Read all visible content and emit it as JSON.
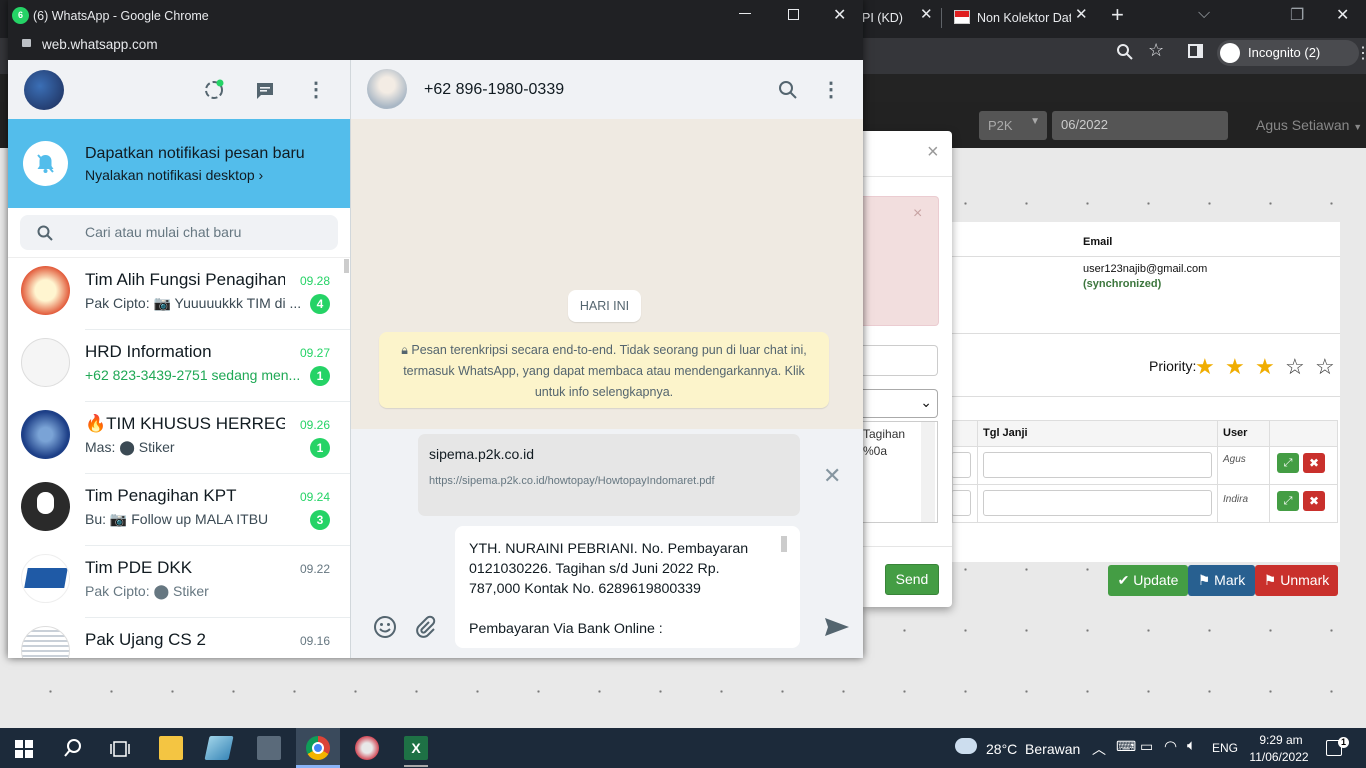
{
  "bg_chrome": {
    "tab1_label": "PI (KD)",
    "tab2_label": "Non Kolektor Dat",
    "incognito_label": "Incognito (2)"
  },
  "bg_page": {
    "program_select": "P2K",
    "period_input": "06/2022",
    "user_menu": "Agus Setiawan",
    "email_header": "Email",
    "email_value": "user123najib@gmail.com",
    "sync_status": "(synchronized)",
    "priority_label": "Priority:",
    "priority_stars": 3,
    "priority_max": 5,
    "col_tgl_janji": "Tgl Janji",
    "col_user": "User",
    "row1_user": "Agus",
    "row2_user": "Indira",
    "textarea_snippet_1": "Tagihan",
    "textarea_snippet_2": "%0a",
    "send_btn": "Send",
    "update_btn": "Update",
    "mark_btn": "Mark",
    "unmark_btn": "Unmark",
    "close_glyph": "×"
  },
  "window": {
    "title": "(6) WhatsApp - Google Chrome",
    "url": "web.whatsapp.com"
  },
  "wa": {
    "notif_title": "Dapatkan notifikasi pesan baru",
    "notif_sub": "Nyalakan notifikasi desktop",
    "search_placeholder": "Cari atau mulai chat baru",
    "chats": [
      {
        "name": "Tim Alih Fungsi Penagihan",
        "time": "09.28",
        "preview": "Pak Cipto: 📷 Yuuuuukkk TIM di ...",
        "badge": "4"
      },
      {
        "name": "HRD Information",
        "time": "09.27",
        "preview": "+62 823-3439-2751 sedang men...",
        "badge": "1"
      },
      {
        "name": "🔥TIM KHUSUS HERREGI...",
        "time": "09.26",
        "preview": "Mas: ⬤ Stiker",
        "badge": "1"
      },
      {
        "name": "Tim Penagihan KPT",
        "time": "09.24",
        "preview": "Bu: 📷 Follow up MALA ITBU",
        "badge": "3"
      },
      {
        "name": "Tim PDE DKK",
        "time": "09.22",
        "preview": "Pak Cipto: ⬤ Stiker",
        "badge": ""
      },
      {
        "name": "Pak Ujang CS 2",
        "time": "09.16",
        "preview": "",
        "badge": ""
      }
    ],
    "contact_number": "+62 896-1980-0339",
    "day_label": "HARI INI",
    "encryption_notice": "Pesan terenkripsi secara end-to-end. Tidak seorang pun di luar chat ini, termasuk WhatsApp, yang dapat membaca atau mendengarkannya. Klik untuk info selengkapnya.",
    "link_title": "sipema.p2k.co.id",
    "link_url": "https://sipema.p2k.co.id/howtopay/HowtopayIndomaret.pdf",
    "compose_text": "YTH. NURAINI PEBRIANI. No. Pembayaran 0121030226. Tagihan s/d Juni 2022 Rp. 787,000 Kontak No. 6289619800339",
    "compose_text_2": "Pembayaran Via Bank Online :"
  },
  "taskbar": {
    "weather": "28°C  Berawan",
    "lang": "ENG",
    "time": "9:29 am",
    "date": "11/06/2022",
    "notif_count": "1"
  },
  "colors": {
    "wa_blue": "#53bdeb",
    "wa_green": "#25d366",
    "bootstrap_green": "#449d44",
    "bootstrap_blue": "#286090",
    "bootstrap_red": "#c9302c"
  }
}
